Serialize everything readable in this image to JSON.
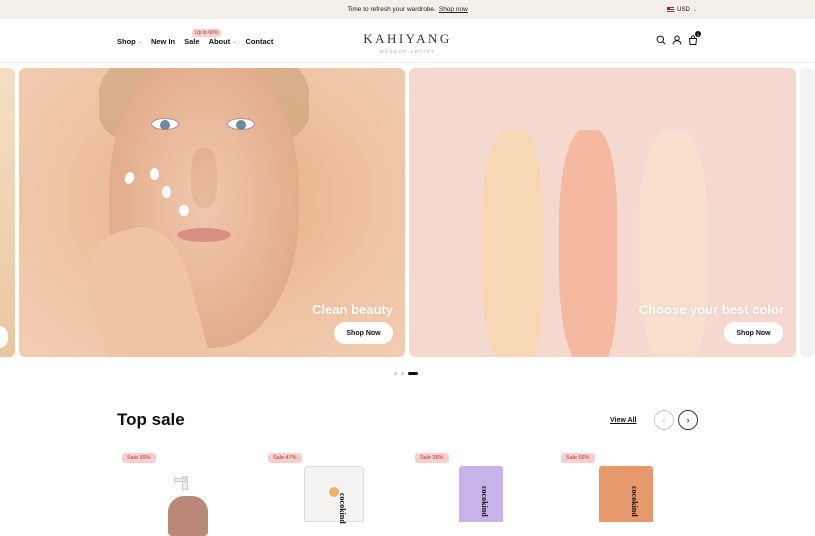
{
  "announcement": {
    "text": "Time to refresh your wardrobe.",
    "link": "Shop now"
  },
  "currency": {
    "label": "USD"
  },
  "nav": [
    {
      "label": "Shop",
      "has_dropdown": true
    },
    {
      "label": "New In",
      "has_dropdown": false
    },
    {
      "label": "Sale",
      "has_dropdown": false,
      "badge": "Up to 60%"
    },
    {
      "label": "About",
      "has_dropdown": true
    },
    {
      "label": "Contact",
      "has_dropdown": false
    }
  ],
  "logo": {
    "title": "KAHIYANG",
    "subtitle": "MAKEUP ARTIST"
  },
  "header_icons": [
    "search-icon",
    "user-icon",
    "cart-icon"
  ],
  "cart": {
    "count": "1"
  },
  "hero": {
    "slides": [
      {
        "caption": "",
        "button": ""
      },
      {
        "caption": "Clean beauty",
        "button": "Shop Now"
      },
      {
        "caption": "Choose your best color",
        "button": "Shop Now"
      }
    ],
    "active_index": 2,
    "dot_count": 3
  },
  "top_sale": {
    "title": "Top sale",
    "view_all": "View All",
    "products": [
      {
        "badge": "Sale 39%",
        "color": "#b98878"
      },
      {
        "badge": "Sale 47%",
        "color": "#f3f3f1",
        "brand": "cocokind"
      },
      {
        "badge": "Sale 38%",
        "color": "#c7b2ea",
        "brand": "cocokind"
      },
      {
        "badge": "Sale 56%",
        "color": "#e69a6c",
        "brand": "cocokind"
      }
    ]
  },
  "colors": {
    "accent": "#111111",
    "badge_bg": "#f6cfcf",
    "badge_text": "#b33333",
    "announce_bg": "#f3f0ea"
  }
}
